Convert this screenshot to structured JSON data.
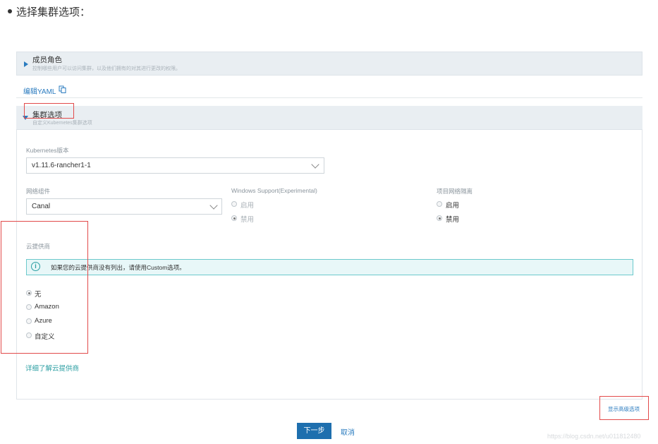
{
  "bullet": {
    "text": "选择集群选项："
  },
  "member_roles": {
    "title": "成员角色",
    "description": "控制哪些用户可以访问集群，以及他们拥有的对其进行更改的权限。"
  },
  "edit_yaml": {
    "label": "编辑YAML"
  },
  "cluster_options": {
    "title": "集群选项",
    "description": "自定义Kubernetes集群选项"
  },
  "kubernetes_version": {
    "label": "Kubernetes版本",
    "value": "v1.11.6-rancher1-1"
  },
  "network_provider": {
    "label": "网络组件",
    "value": "Canal"
  },
  "windows_support": {
    "label": "Windows Support(Experimental)",
    "options": [
      {
        "label": "启用",
        "checked": false,
        "disabled": true
      },
      {
        "label": "禁用",
        "checked": true,
        "disabled": true
      }
    ]
  },
  "project_isolation": {
    "label": "项目网络隔离",
    "options": [
      {
        "label": "启用",
        "checked": false
      },
      {
        "label": "禁用",
        "checked": true
      }
    ]
  },
  "cloud_provider": {
    "label": "云提供商",
    "info": "如果您的云提供商没有列出，请使用Custom选项。",
    "options": [
      {
        "label": "无",
        "checked": true
      },
      {
        "label": "Amazon",
        "checked": false
      },
      {
        "label": "Azure",
        "checked": false
      },
      {
        "label": "自定义",
        "checked": false
      }
    ],
    "learn_more": "详细了解云提供商"
  },
  "advanced_link": "显示高级选项",
  "buttons": {
    "next": "下一步",
    "cancel": "取消"
  },
  "watermark": "https://blog.csdn.net/u011812480",
  "colors": {
    "accent": "#2a7bbf",
    "primary_button": "#1e6fae",
    "info_border": "#6cc9cc",
    "annotation_red": "#e24a4a"
  }
}
